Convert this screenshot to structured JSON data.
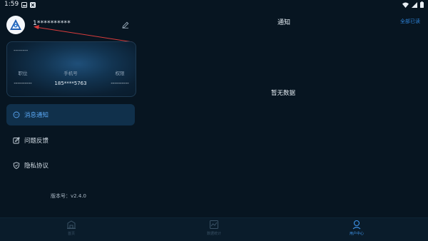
{
  "status_bar": {
    "time": "1:59"
  },
  "profile": {
    "username": "1**********",
    "card_title": "--------",
    "stats": [
      {
        "label": "职位",
        "value": "----------"
      },
      {
        "label": "手机号",
        "value": "185****5763"
      },
      {
        "label": "权限",
        "value": "----------"
      }
    ]
  },
  "menu": [
    {
      "label": "消息通知",
      "icon": "message-icon",
      "active": true
    },
    {
      "label": "问题反馈",
      "icon": "feedback-icon",
      "active": false
    },
    {
      "label": "隐私协议",
      "icon": "shield-icon",
      "active": false
    }
  ],
  "version": "版本号：v2.4.0",
  "notifications": {
    "title": "通知",
    "read_all": "全部已读",
    "empty_text": "暂无数据"
  },
  "tabbar": [
    {
      "label": "首页",
      "icon": "home-icon"
    },
    {
      "label": "数据统计",
      "icon": "chart-icon"
    },
    {
      "label": "用户中心",
      "icon": "user-icon"
    }
  ],
  "colors": {
    "accent": "#3f95ea",
    "background": "#071521",
    "annotation_arrow": "#d93c3c"
  }
}
